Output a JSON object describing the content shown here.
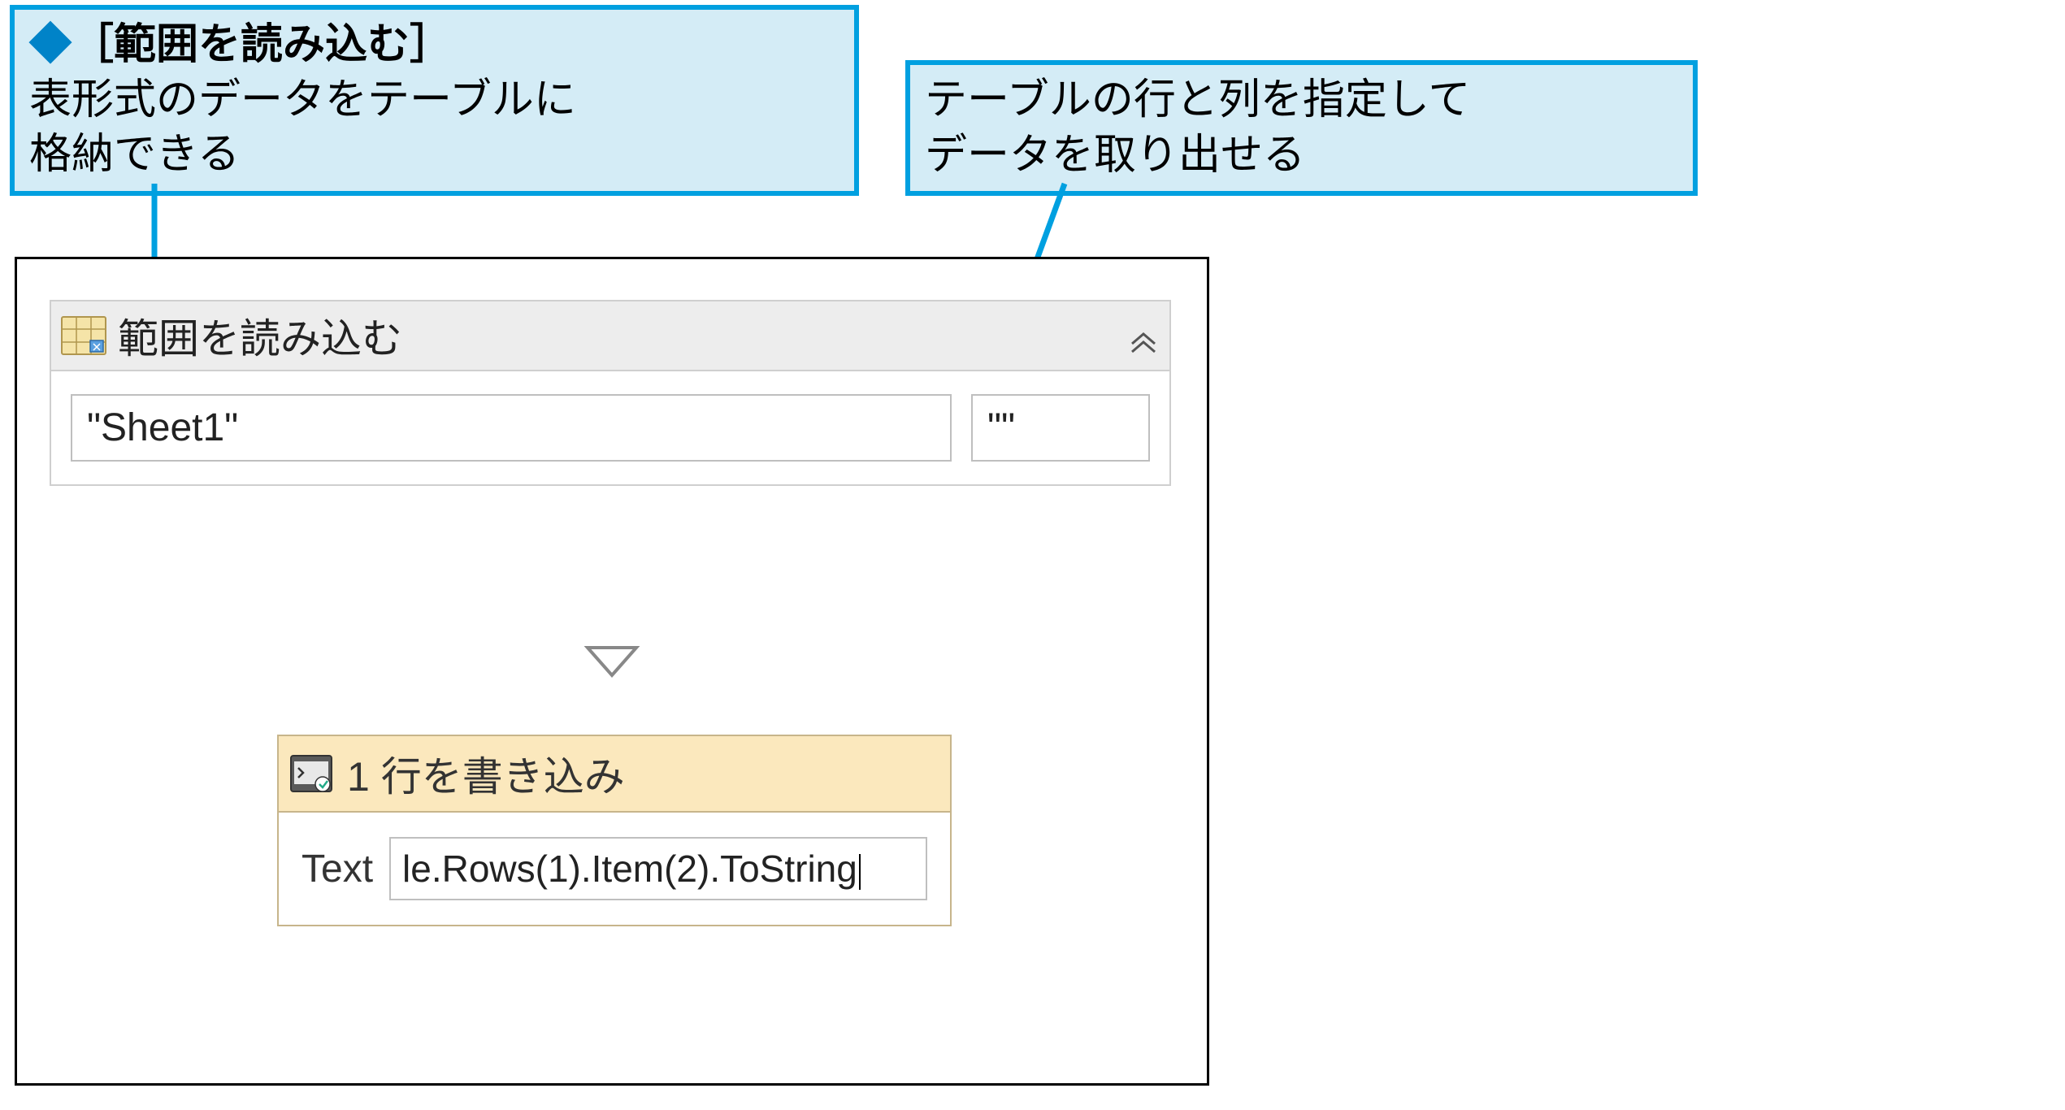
{
  "callouts": {
    "left": {
      "diamond": "◆",
      "title": "［範囲を読み込む］",
      "body_line1": "表形式のデータをテーブルに",
      "body_line2": "格納できる"
    },
    "right": {
      "line1": "テーブルの行と列を指定して",
      "line2": "データを取り出せる"
    }
  },
  "read_range": {
    "title": "範囲を読み込む",
    "sheet_value": "\"Sheet1\"",
    "range_value": "\"\""
  },
  "write_line": {
    "title": "1 行を書き込み",
    "label": "Text",
    "value": "le.Rows(1).Item(2).ToString"
  }
}
